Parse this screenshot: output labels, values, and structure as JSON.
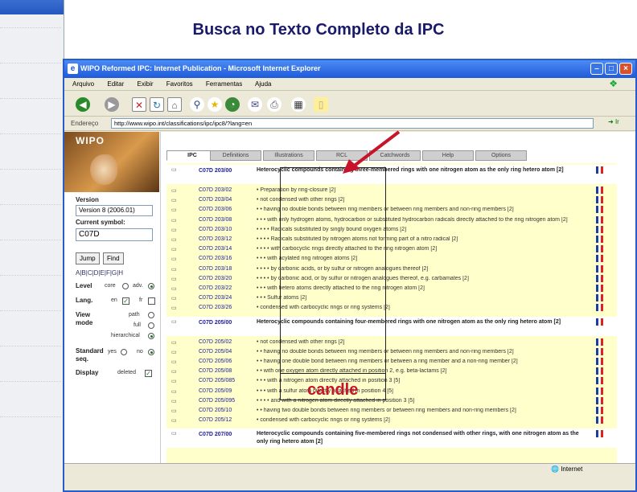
{
  "slide_title": "Busca no Texto Completo da IPC",
  "background_window": {
    "title": "",
    "rows": [
      "",
      "",
      "",
      "",
      "",
      "",
      "",
      "",
      "",
      "",
      "",
      ""
    ]
  },
  "window": {
    "title": "WIPO Reformed IPC: Internet Publication - Microsoft Internet Explorer",
    "menu": [
      "Arquivo",
      "Editar",
      "Exibir",
      "Favoritos",
      "Ferramentas",
      "Ajuda"
    ],
    "address_label": "Endereço",
    "address_value": "http://www.wipo.int/classifications/ipc/ipc8/?lang=en",
    "go_label": "Ir",
    "status_zone": "Internet"
  },
  "sidebar": {
    "logo_text": "WIPO",
    "version_label": "Version",
    "version_value": "Version 8 (2006.01)",
    "current_symbol_label": "Current symbol:",
    "current_symbol_value": "C07D",
    "jump_button": "Jump",
    "find_button": "Find",
    "sections": "A|B|C|D|E|F|G|H",
    "level_label": "Level",
    "level_opt1": "core",
    "level_opt2": "adv.",
    "lang_label": "Lang.",
    "lang_opt1": "en",
    "lang_opt2": "fr",
    "view_label": "View mode",
    "view_opt1": "path",
    "view_opt2": "full",
    "view_opt3": "hierarchical",
    "std_label": "Standard seq.",
    "std_opt1": "yes",
    "std_opt2": "no",
    "display_label": "Display",
    "display_opt1": "deleted"
  },
  "tabs": [
    "IPC",
    "Definitions",
    "Illustrations",
    "RCL",
    "Catchwords",
    "Help",
    "Options"
  ],
  "rows": [
    {
      "code": "C07D 203/00",
      "text": "Heterocyclic compounds containing three-membered rings with one nitrogen atom as the only ring hetero atom [2]",
      "hdr": true
    },
    {
      "code": "C07D 203/02",
      "text": "• Preparation by ring-closure [2]"
    },
    {
      "code": "C07D 203/04",
      "text": "• not condensed with other rings [2]"
    },
    {
      "code": "C07D 203/06",
      "text": "• • having no double bonds between ring members or between ring members and non-ring members [2]"
    },
    {
      "code": "C07D 203/08",
      "text": "• • • with only hydrogen atoms, hydrocarbon or substituted hydrocarbon radicals directly attached to the ring nitrogen atom [2]"
    },
    {
      "code": "C07D 203/10",
      "text": "• • • • Radicals substituted by singly bound oxygen atoms [2]"
    },
    {
      "code": "C07D 203/12",
      "text": "• • • • Radicals substituted by nitrogen atoms not forming part of a nitro radical [2]"
    },
    {
      "code": "C07D 203/14",
      "text": "• • • • with carbocyclic rings directly attached to the ring nitrogen atom [2]"
    },
    {
      "code": "C07D 203/16",
      "text": "• • • with acylated ring nitrogen atoms [2]"
    },
    {
      "code": "C07D 203/18",
      "text": "• • • • by carbonic acids, or by sulfur or nitrogen analogues thereof [2]"
    },
    {
      "code": "C07D 203/20",
      "text": "• • • • by carbonic acid, or by sulfur or nitrogen analogues thereof, e.g. carbamates [2]"
    },
    {
      "code": "C07D 203/22",
      "text": "• • • with hetero atoms directly attached to the ring nitrogen atom [2]"
    },
    {
      "code": "C07D 203/24",
      "text": "• • • Sulfur atoms [2]"
    },
    {
      "code": "C07D 203/26",
      "text": "• condensed with carbocyclic rings or ring systems [2]"
    },
    {
      "code": "C07D 205/00",
      "text": "Heterocyclic compounds containing four-membered rings with one nitrogen atom as the only ring hetero atom [2]",
      "hdr": true
    },
    {
      "code": "C07D 205/02",
      "text": "• not condensed with other rings [2]"
    },
    {
      "code": "C07D 205/04",
      "text": "• • having no double bonds between ring members or between ring members and non-ring members [2]"
    },
    {
      "code": "C07D 205/06",
      "text": "• • having one double bond between ring members or between a ring member and a non-ring member [2]"
    },
    {
      "code": "C07D 205/08",
      "text": "• • with one oxygen atom directly attached in position 2, e.g. beta-lactams [2]"
    },
    {
      "code": "C07D 205/085",
      "text": "• • • with a nitrogen atom directly attached in position 3 [5]"
    },
    {
      "code": "C07D 205/09",
      "text": "• • • with a sulfur atom directly attached in position 4 [5]"
    },
    {
      "code": "C07D 205/095",
      "text": "• • • • and with a nitrogen atom directly attached in position 3 [5]"
    },
    {
      "code": "C07D 205/10",
      "text": "• • having two double bonds between ring members or between ring members and non-ring members [2]"
    },
    {
      "code": "C07D 205/12",
      "text": "• condensed with carbocyclic rings or ring systems [2]"
    },
    {
      "code": "C07D 207/00",
      "text": "Heterocyclic compounds containing five-membered rings not condensed with other rings, with one nitrogen atom as the only ring hetero atom [2]",
      "hdr": true
    }
  ],
  "annotation": {
    "label": "candle",
    "label_color": "#c8142a"
  }
}
